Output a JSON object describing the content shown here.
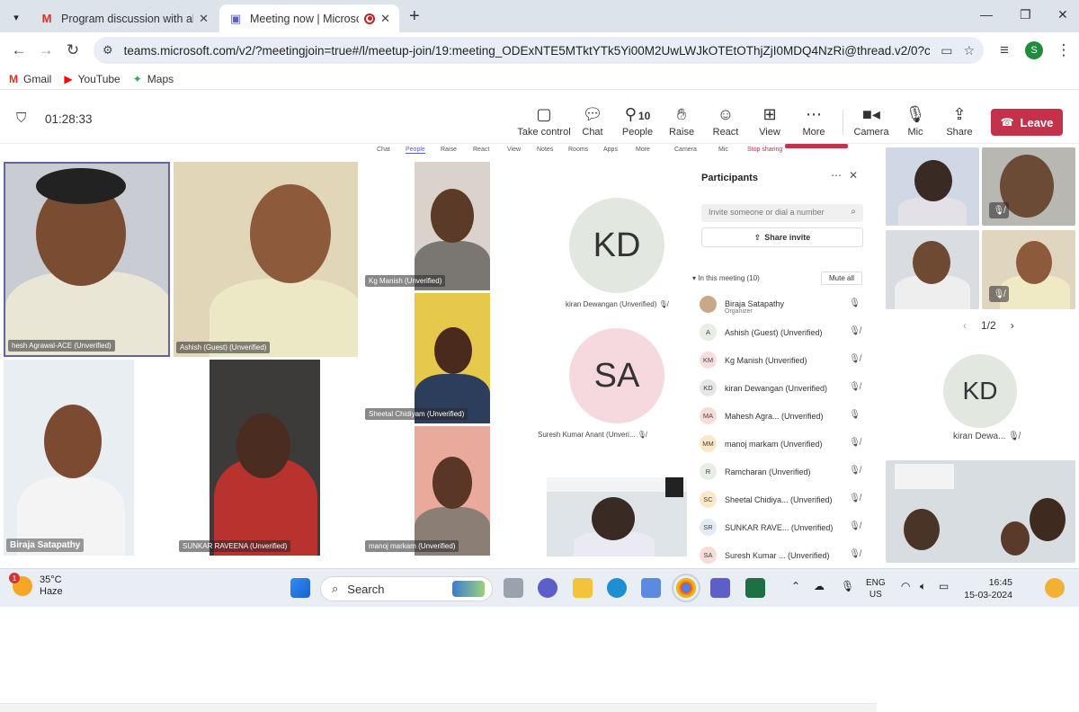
{
  "browser": {
    "tabs": [
      {
        "title": "Program discussion with all staf",
        "favicon": "gmail-icon"
      },
      {
        "title": "Meeting now | Microsoft Te",
        "favicon": "teams-icon",
        "recording": true
      }
    ],
    "url": "teams.microsoft.com/v2/?meetingjoin=true#/l/meetup-join/19:meeting_ODExNTE5MTktYTk5Yi00M2UwLWJkOTEtOThjZjI0MDQ4NzRi@thread.v2/0?context=%7b\"T...",
    "profile_initial": "S",
    "bookmarks": [
      {
        "label": "Gmail",
        "icon": "gmail-icon",
        "color": "#d93025"
      },
      {
        "label": "YouTube",
        "icon": "youtube-icon",
        "color": "#ff0000"
      },
      {
        "label": "Maps",
        "icon": "maps-icon",
        "color": "#34a853"
      }
    ]
  },
  "meeting": {
    "timer": "01:28:33",
    "controls": [
      {
        "label": "Take control",
        "icon": "take-control-icon"
      },
      {
        "label": "Chat",
        "icon": "chat-icon"
      },
      {
        "label": "People",
        "icon": "people-icon",
        "count": "10"
      },
      {
        "label": "Raise",
        "icon": "raise-hand-icon"
      },
      {
        "label": "React",
        "icon": "react-icon"
      },
      {
        "label": "View",
        "icon": "view-icon"
      },
      {
        "label": "More",
        "icon": "more-icon"
      },
      {
        "label": "Camera",
        "icon": "camera-icon"
      },
      {
        "label": "Mic",
        "icon": "mic-icon"
      },
      {
        "label": "Share",
        "icon": "share-icon"
      }
    ],
    "leave_label": "Leave"
  },
  "shared_screen": {
    "mini_toolbar": [
      "Chat",
      "People",
      "Raise",
      "React",
      "View",
      "Notes",
      "Rooms",
      "Apps",
      "More",
      "Camera",
      "Mic",
      "Stop sharing"
    ],
    "tiles": [
      {
        "name": "hesh Agrawal-ACE (Unverified)"
      },
      {
        "name": "Ashish (Guest) (Unverified)"
      },
      {
        "name": "Kg Manish (Unverified)"
      },
      {
        "name": "Sheetal Chidiyam (Unverified)"
      },
      {
        "name": "Biraja Satapathy"
      },
      {
        "name": "SUNKAR RAVEENA (Unverified)"
      },
      {
        "name": "manoj markam (Unverified)"
      }
    ],
    "avatars": [
      {
        "initials": "KD",
        "caption": "kiran Dewangan (Unverified)",
        "bg": "#e2e7e0",
        "fg": "#333333"
      },
      {
        "initials": "SA",
        "caption": "Suresh Kumar Anant (Unveri...",
        "bg": "#f6d9df",
        "fg": "#333333"
      }
    ],
    "participants_panel": {
      "title": "Participants",
      "invite_placeholder": "Invite someone or dial a number",
      "share_invite": "Share invite",
      "section": "In this meeting (10)",
      "mute_all": "Mute all",
      "list": [
        {
          "initials": "",
          "name": "Biraja Satapathy",
          "sub": "Organizer",
          "mic": "on",
          "bg": "#c9a88a"
        },
        {
          "initials": "A",
          "name": "Ashish (Guest) (Unverified)",
          "sub": "",
          "mic": "off",
          "bg": "#e7eee3"
        },
        {
          "initials": "KM",
          "name": "Kg Manish (Unverified)",
          "sub": "",
          "mic": "off",
          "bg": "#f6dede"
        },
        {
          "initials": "KD",
          "name": "kiran Dewangan (Unverified)",
          "sub": "",
          "mic": "off",
          "bg": "#e6e6e6"
        },
        {
          "initials": "MA",
          "name": "Mahesh Agra...  (Unverified)",
          "sub": "",
          "mic": "on",
          "bg": "#f8dcd8"
        },
        {
          "initials": "MM",
          "name": "manoj markam (Unverified)",
          "sub": "",
          "mic": "off",
          "bg": "#fbe8c8"
        },
        {
          "initials": "R",
          "name": "Ramcharan (Unverified)",
          "sub": "",
          "mic": "off",
          "bg": "#e7eee3"
        },
        {
          "initials": "SC",
          "name": "Sheetal Chidiya... (Unverified)",
          "sub": "",
          "mic": "off",
          "bg": "#fbe8c8"
        },
        {
          "initials": "SR",
          "name": "SUNKAR RAVE... (Unverified)",
          "sub": "",
          "mic": "off",
          "bg": "#e3ebf4"
        },
        {
          "initials": "SA",
          "name": "Suresh Kumar ... (Unverified)",
          "sub": "",
          "mic": "off",
          "bg": "#f8dcd8"
        }
      ]
    }
  },
  "right_strip": {
    "pager": "1/2",
    "avatar": {
      "initials": "KD",
      "caption": "kiran Dewa..."
    }
  },
  "taskbar": {
    "weather_temp": "35°C",
    "weather_desc": "Haze",
    "weather_badge": "1",
    "search_label": "Search",
    "lang_line1": "ENG",
    "lang_line2": "US",
    "time": "16:45",
    "date": "15-03-2024"
  }
}
